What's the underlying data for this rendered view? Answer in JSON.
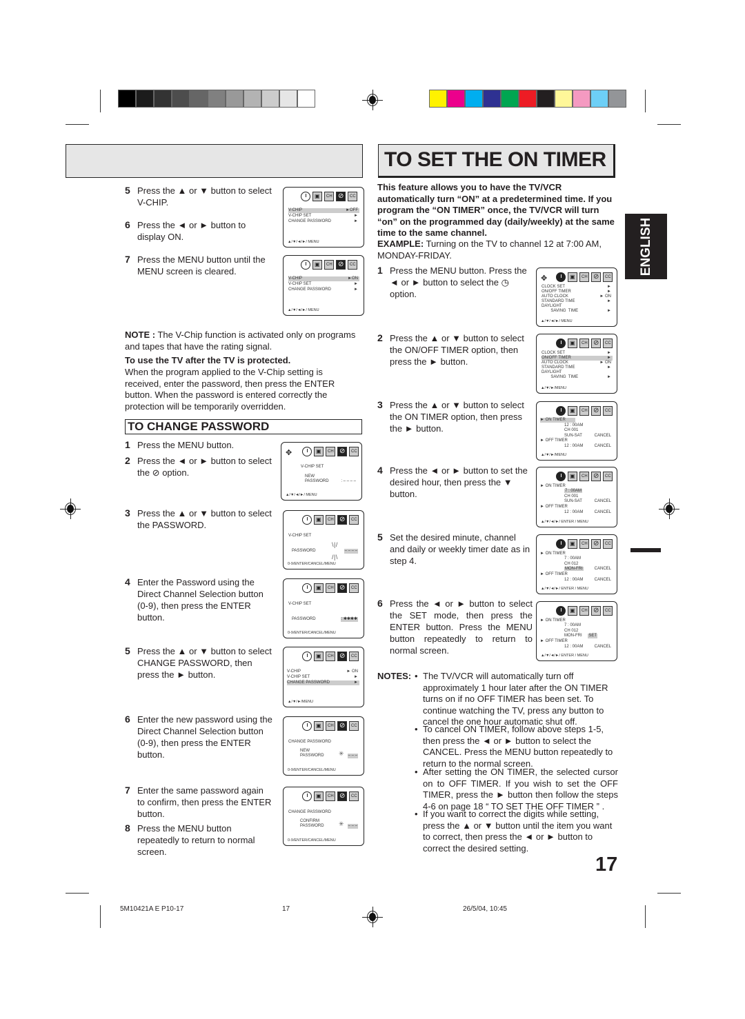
{
  "print_marks": {
    "grayscale_swatches": [
      "#000000",
      "#1c1c1c",
      "#333333",
      "#4d4d4d",
      "#666666",
      "#808080",
      "#999999",
      "#b3b3b3",
      "#cccccc",
      "#e6e6e6",
      "#ffffff"
    ],
    "color_swatches": [
      "#fff200",
      "#ec008c",
      "#00aeef",
      "#2e3192",
      "#00a651",
      "#ed1c24",
      "#231f20",
      "#fff799",
      "#f49ac1",
      "#6dcff6",
      "#939598"
    ]
  },
  "left": {
    "steps_top": [
      {
        "num": "5",
        "text": "Press the ▲ or ▼ button to select  V-CHIP."
      },
      {
        "num": "6",
        "text": "Press the ◄ or ► button to display ON."
      },
      {
        "num": "7",
        "text": "Press the MENU button until the MENU screen is cleared."
      }
    ],
    "note_label": "NOTE :",
    "note_text": "The V-Chip function is activated only on programs and tapes that have the rating signal.",
    "protected_heading": "To use the TV after the TV is protected.",
    "protected_text": "When the program applied to the V-Chip setting is received, enter the password, then press the ENTER button. When the password is entered correctly the protection will be temporarily overridden.",
    "section_title": "TO CHANGE PASSWORD",
    "steps": [
      {
        "num": "1",
        "text": "Press the MENU button."
      },
      {
        "num": "2",
        "text": "Press the ◄ or ► button to select the ⊘ option."
      },
      {
        "num": "3",
        "text": "Press the ▲ or ▼ button to select the PASSWORD."
      },
      {
        "num": "4",
        "text": "Enter the Password using the Direct Channel Selection button (0-9), then press the ENTER button."
      },
      {
        "num": "5",
        "text": "Press the ▲ or ▼ button to select CHANGE PASSWORD, then press the ► button."
      },
      {
        "num": "6",
        "text": "Enter the new password using the Direct Channel Selection button (0-9), then press the ENTER button."
      },
      {
        "num": "7",
        "text": "Enter the same password again to confirm, then press the ENTER button."
      },
      {
        "num": "8",
        "text": "Press the MENU button repeatedly to return to normal screen."
      }
    ],
    "screens": {
      "s1": {
        "rows": [
          {
            "label": "V-CHIP",
            "value": "►OFF"
          },
          {
            "label": "V-CHIP  SET",
            "value": "►"
          },
          {
            "label": "CHANGE  PASSWORD",
            "value": "►"
          }
        ],
        "footer": "▲/▼/◄/►/ MENU"
      },
      "s2": {
        "rows": [
          {
            "label": "V-CHIP",
            "value": "►ON"
          },
          {
            "label": "V-CHIP  SET",
            "value": "►"
          },
          {
            "label": "CHANGE  PASSWORD",
            "value": "►"
          }
        ],
        "footer": "▲/▼/◄/►/ MENU"
      },
      "s3": {
        "title": "V-CHIP  SET",
        "label1": "NEW",
        "label2": "PASSWORD",
        "value": ": – – – –",
        "footer": "▲/▼/◄/►/ MENU"
      },
      "s4": {
        "title": "V-CHIP SET",
        "label": "PASSWORD",
        "value": "– – – –",
        "footer": "0-9/ENTER/CANCEL/MENU"
      },
      "s5": {
        "title": "V-CHIP SET",
        "label": "PASSWORD",
        "value": ": ✱✱✱✱",
        "footer": "0-9/ENTER/CANCEL/MENU"
      },
      "s6": {
        "rows": [
          {
            "label": "V-CHIP",
            "value": "► ON"
          },
          {
            "label": "V-CHIP SET",
            "value": "►"
          },
          {
            "label": "CHANGE PASSWORD",
            "value": "►"
          }
        ],
        "footer": "▲/▼/►/MENU"
      },
      "s7": {
        "title": "CHANGE  PASSWORD",
        "label1": "NEW",
        "label2": "PASSWORD",
        "value": "– – –",
        "footer": "0-9/ENTER/CANCEL/MENU"
      },
      "s8": {
        "title": "CHANGE  PASSWORD",
        "label1": "CONFIRM",
        "label2": "PASSWORD",
        "value": "– – –",
        "footer": "0-9/ENTER/CANCEL/MENU"
      }
    }
  },
  "right": {
    "title": "TO SET THE ON TIMER",
    "intro_bold": "This feature allows you to have the TV/VCR automatically turn “ON” at a predetermined time. If you program the “ON TIMER” once, the TV/VCR will turn “on” on the programmed day (daily/weekly) at the same time to the same channel.",
    "example_label": "EXAMPLE:",
    "example_text": "Turning on the TV to channel 12 at 7:00 AM, MONDAY-FRIDAY.",
    "steps": [
      {
        "num": "1",
        "text": "Press the MENU button. Press the ◄ or ► button to select the ◷ option."
      },
      {
        "num": "2",
        "text": "Press the ▲ or ▼ button to select the ON/OFF TIMER option, then press the ► button."
      },
      {
        "num": "3",
        "text": "Press the ▲ or ▼ button to select the ON TIMER option, then press the ► button."
      },
      {
        "num": "4",
        "text": "Press the ◄ or ► button to set the desired hour, then press the ▼ button."
      },
      {
        "num": "5",
        "text": "Set the desired minute, channel and daily or weekly timer date as in step 4."
      },
      {
        "num": "6",
        "text": "Press the ◄ or ► button to select the SET mode, then press the ENTER button. Press the MENU button repeatedly to return to normal screen."
      }
    ],
    "screens": {
      "t1": {
        "rows": [
          {
            "label": "CLOCK  SET",
            "value": "►"
          },
          {
            "label": "ON/OFF  TIMER",
            "value": "►"
          },
          {
            "label": "AUTO  CLOCK",
            "value": "► ON"
          },
          {
            "label": "STANDARD  TIME",
            "value": "►"
          },
          {
            "label": "DAYLIGHT",
            "value": ""
          },
          {
            "label": "        SAVING  TIME",
            "value": "►"
          }
        ],
        "footer": "▲/▼/◄/►/ MENU"
      },
      "t2": {
        "rows": [
          {
            "label": "CLOCK  SET",
            "value": "►"
          },
          {
            "label": "ON/OFF  TIMER",
            "value": "►"
          },
          {
            "label": "AUTO  CLOCK",
            "value": "► ON"
          },
          {
            "label": "STANDARD  TIME",
            "value": "►"
          },
          {
            "label": "DAYLIGHT",
            "value": ""
          },
          {
            "label": "        SAVING  TIME",
            "value": "►"
          }
        ],
        "footer": "▲/▼/►/MENU"
      },
      "t3": {
        "on_timer": "ON  TIMER",
        "time": "12 : 00AM",
        "channel": "CH 001",
        "days": "SUN-SAT",
        "cancel": "CANCEL",
        "off_timer": "OFF TIMER",
        "off_time": "12 : 00AM",
        "off_cancel": "CANCEL",
        "footer": "▲/▼/►/MENU"
      },
      "t4": {
        "on_timer": "ON TIMER",
        "time": "7 : 00AM",
        "channel": "CH 001",
        "days": "SUN-SAT",
        "cancel": "CANCEL",
        "off_timer": "OFF TIMER",
        "off_time": "12 : 00AM",
        "off_cancel": "CANCEL",
        "footer": "▲/▼/◄/►/ ENTER / MENU"
      },
      "t5": {
        "on_timer": "ON TIMER",
        "time": "7 : 00AM",
        "channel": "CH 012",
        "days": "MON-FRI",
        "cancel": "CANCEL",
        "off_timer": "OFF TIMER",
        "off_time": "12 : 00AM",
        "off_cancel": "CANCEL",
        "footer": "▲/▼/◄/►/ ENTER / MENU"
      },
      "t6": {
        "on_timer": "ON TIMER",
        "time": "7 : 00AM",
        "channel": "CH 012",
        "days": "MON-FRI",
        "set": "SET",
        "off_timer": "OFF TIMER",
        "off_time": "12 : 00AM",
        "off_cancel": "CANCEL",
        "footer": "▲/▼/◄/►/ ENTER / MENU"
      }
    },
    "notes_label": "NOTES:",
    "notes": [
      "The TV/VCR will automatically turn off approximately 1 hour later after the ON TIMER turns on if no OFF TIMER has been set. To continue watching the TV, press any button to cancel the one hour automatic shut off.",
      "To cancel ON TIMER, follow above steps 1-5, then press the ◄ or ► button to select the CANCEL. Press the MENU button repeatedly to return to the normal screen.",
      "After setting the ON TIMER, the selected cursor on to OFF TIMER. If you wish to set the OFF TIMER, press the ► button then follow the steps 4-6 on page 18 “ TO SET THE OFF TIMER ” .",
      "If you want to correct the digits while setting, press the ▲ or ▼ button until the item you want to correct, then press the ◄ or ► button to correct the desired setting."
    ]
  },
  "language_tab": "ENGLISH",
  "page_number": "17",
  "footer": {
    "code": "5M10421A E P10-17",
    "page": "17",
    "date": "26/5/04, 10:45"
  }
}
